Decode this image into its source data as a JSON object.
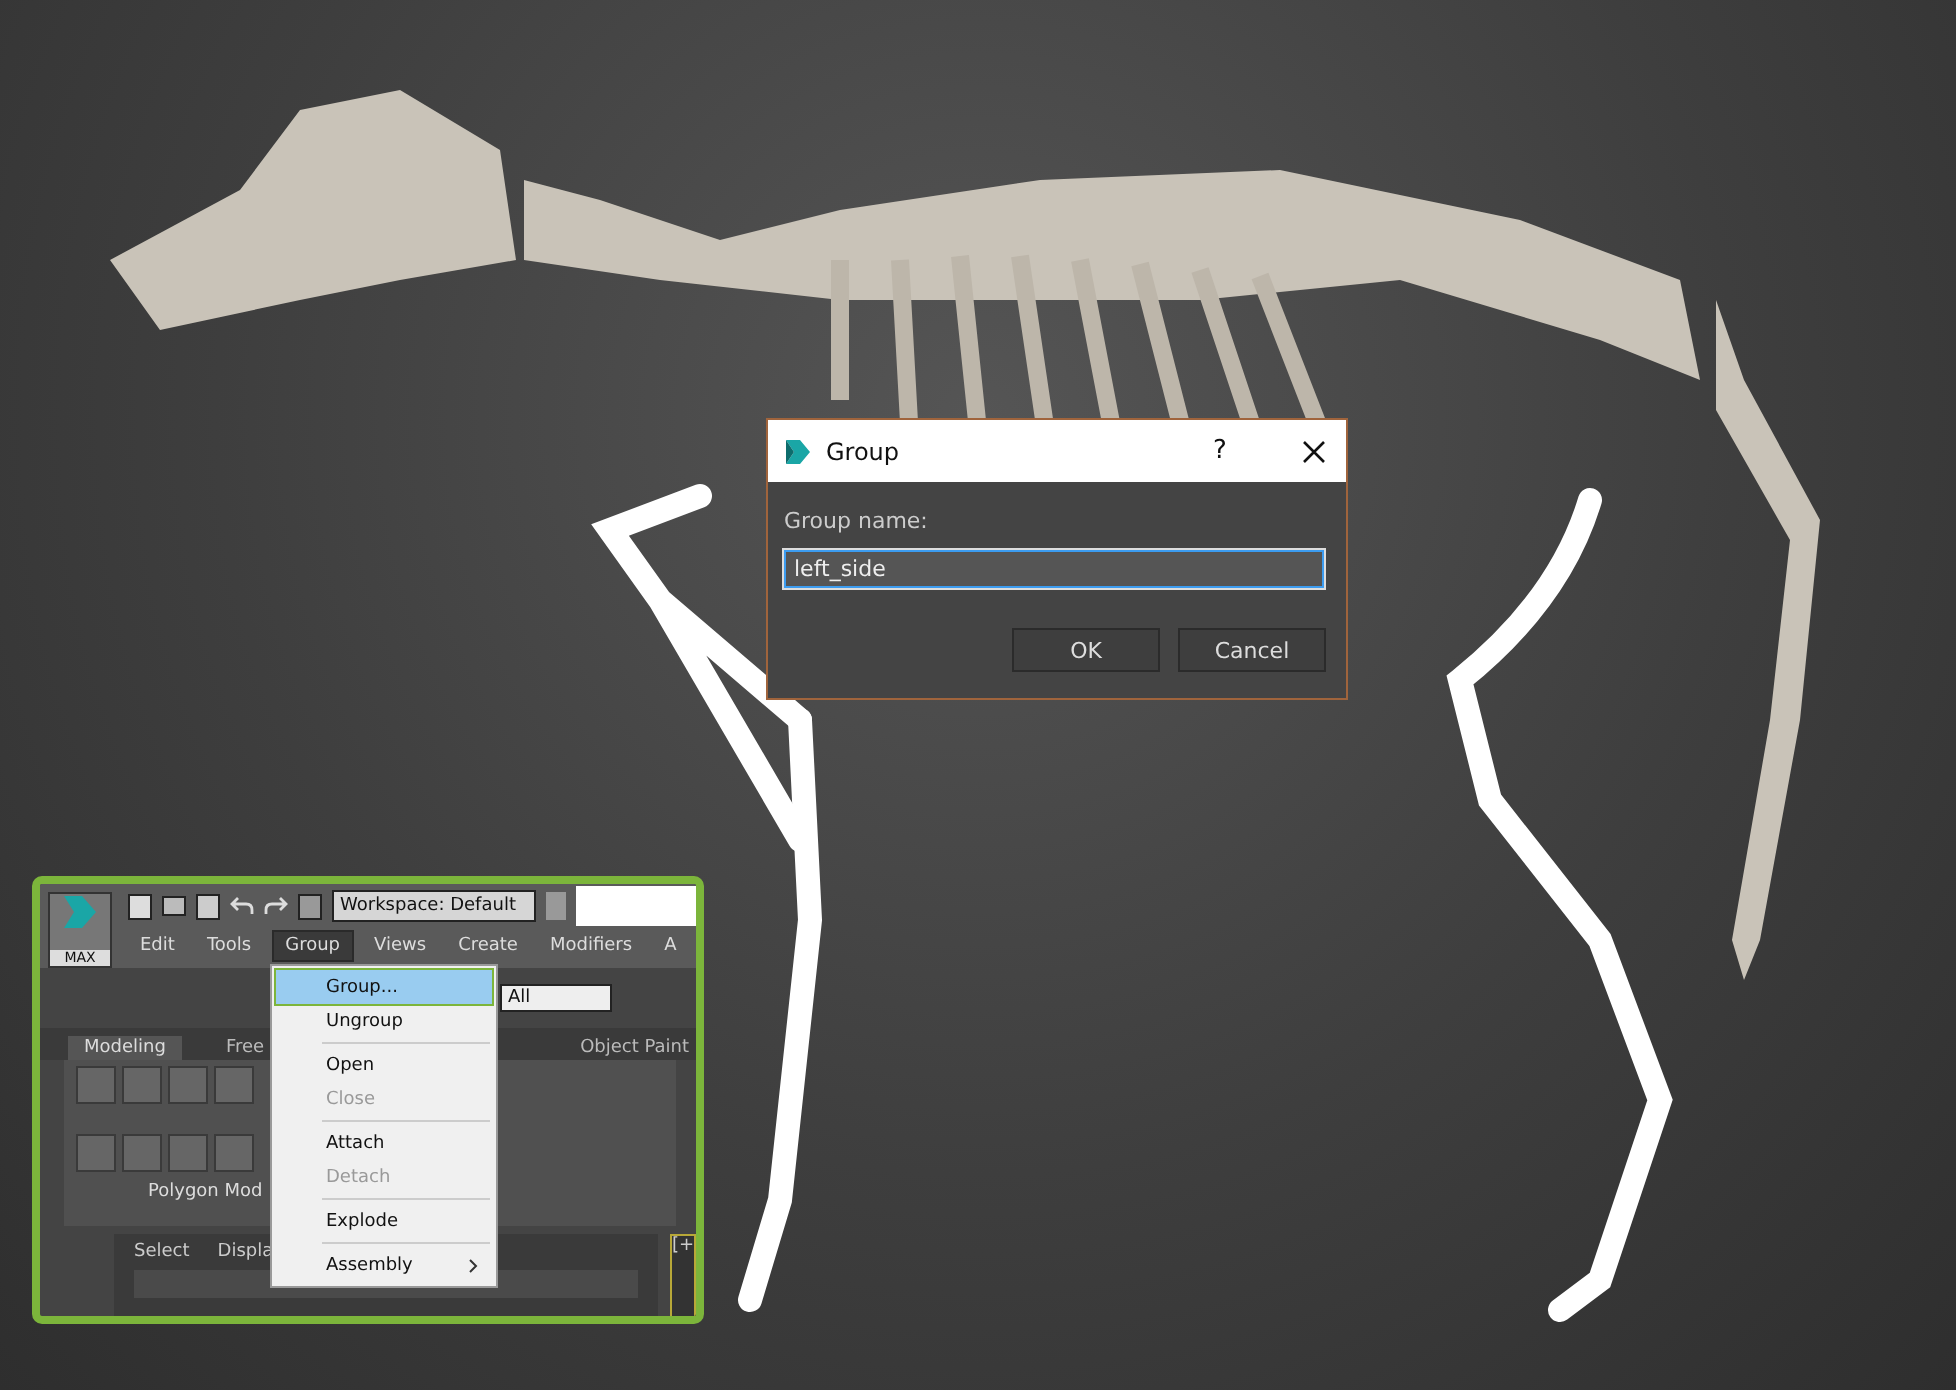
{
  "dialog": {
    "title": "Group",
    "help": "?",
    "field_label": "Group name:",
    "value": "left_side",
    "buttons": [
      {
        "label": "OK",
        "default": false
      },
      {
        "label": "Cancel",
        "default": false
      }
    ]
  },
  "inset": {
    "app_label": "MAX",
    "workspace": "Workspace: Default",
    "menu": [
      {
        "label": "Edit",
        "selected": false
      },
      {
        "label": "Tools",
        "selected": false
      },
      {
        "label": "Group",
        "selected": true
      },
      {
        "label": "Views",
        "selected": false
      },
      {
        "label": "Create",
        "selected": false
      },
      {
        "label": "Modifiers",
        "selected": false
      },
      {
        "label": "A",
        "selected": false
      }
    ],
    "filter": "All",
    "ribbon_tabs": [
      {
        "label": "Modeling",
        "selected": true
      },
      {
        "label": "Free",
        "selected": false
      },
      {
        "label": "Object Paint",
        "selected": false
      }
    ],
    "ribbon_label": "Polygon Mod",
    "panel_tabs": [
      "Select",
      "Displa"
    ],
    "viewport_label": "[+",
    "dropdown": [
      {
        "kind": "item",
        "label": "Group...",
        "highlighted": true,
        "disabled": false
      },
      {
        "kind": "item",
        "label": "Ungroup",
        "highlighted": false,
        "disabled": false
      },
      {
        "kind": "separator"
      },
      {
        "kind": "item",
        "label": "Open",
        "highlighted": false,
        "disabled": false
      },
      {
        "kind": "item",
        "label": "Close",
        "highlighted": false,
        "disabled": true
      },
      {
        "kind": "separator"
      },
      {
        "kind": "item",
        "label": "Attach",
        "highlighted": false,
        "disabled": false
      },
      {
        "kind": "item",
        "label": "Detach",
        "highlighted": false,
        "disabled": true
      },
      {
        "kind": "separator"
      },
      {
        "kind": "item",
        "label": "Explode",
        "highlighted": false,
        "disabled": false
      },
      {
        "kind": "separator"
      },
      {
        "kind": "submenu",
        "label": "Assembly",
        "highlighted": false,
        "disabled": false
      }
    ]
  }
}
